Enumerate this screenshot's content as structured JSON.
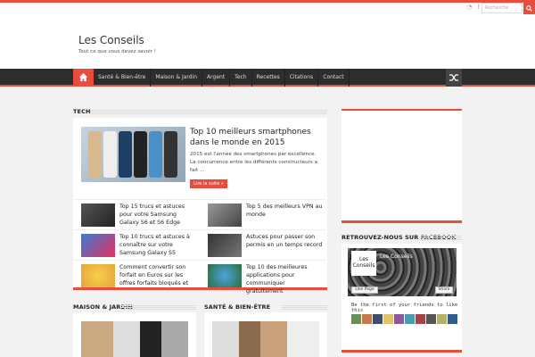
{
  "topbar": {
    "search_placeholder": "Recherche"
  },
  "header": {
    "title": "Les Conseils",
    "tagline": "Tout ce que vous devez savoir !"
  },
  "nav": {
    "items": [
      {
        "label": "Santé & Bien-être"
      },
      {
        "label": "Maison & Jardin"
      },
      {
        "label": "Argent"
      },
      {
        "label": "Tech"
      },
      {
        "label": "Recettes"
      },
      {
        "label": "Citations"
      },
      {
        "label": "Contact"
      }
    ]
  },
  "tech": {
    "section_title": "TECH",
    "featured": {
      "title": "Top 10 meilleurs smartphones dans le monde en 2015",
      "excerpt": "2015 est l'année des smartphones par excellence. La concurrence entre les différents constructeurs a fait ...",
      "more_label": "Lire la suite »"
    },
    "items": [
      {
        "title": "Top 15 trucs et astuces pour votre Samsung Galaxy S6 et S6 Edge"
      },
      {
        "title": "Top 5 des meilleurs VPN au monde"
      },
      {
        "title": "Top 10 trucs et astuces à connaître sur votre Samsung Galaxy S5"
      },
      {
        "title": "Astuces pour passer son permis en un temps record"
      },
      {
        "title": "Comment convertir son forfait en Euros sur les offres forfaits bloqués et"
      },
      {
        "title": "Top 10 des meilleures applications pour communiquer gratuitement"
      }
    ]
  },
  "sections": {
    "maison_title": "MAISON & JARDIN",
    "sante_title": "SANTÉ & BIEN-ÊTRE"
  },
  "facebook": {
    "section_title": "RETROUVEZ-NOUS SUR FACEBOOK",
    "logo_text": "Les Conseils",
    "page_name": "Les Conseils",
    "like_label": "Like Page",
    "share_label": "Share",
    "friends_text": "Be the first of your friends to like this"
  },
  "colors": {
    "accent": "#e74c3c",
    "nav_bg": "#2d2d2d"
  }
}
